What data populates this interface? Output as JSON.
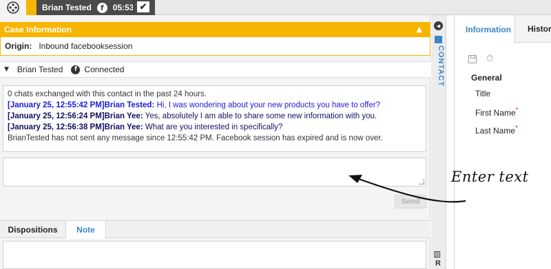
{
  "toolbar": {
    "contact_name": "Brian Tested",
    "channel_icon": "facebook-icon",
    "timer": "05:53"
  },
  "case": {
    "header": "Case Information",
    "origin_label": "Origin:",
    "origin_value": "Inbound facebooksession"
  },
  "contact": {
    "name": "Brian Tested",
    "status": "Connected"
  },
  "transcript": {
    "summary": "0 chats exchanged with this contact in the past 24 hours.",
    "messages": [
      {
        "meta": "[January 25, 12:55:42 PM]Brian Tested:",
        "text": " Hi, I was wondering about your new products you have to offer?"
      },
      {
        "meta": "[January 25, 12:56:24 PM]Brian Yee:",
        "text": " Yes, absolutely I am able to share some new information with you."
      },
      {
        "meta": "[January 25, 12:56:38 PM]Brian Yee:",
        "text": " What are you interested in specifically?"
      }
    ],
    "system_note": "BrianTested has not sent any message since 12:55:42 PM. Facebook session has expired and is now over."
  },
  "composer": {
    "send_label": "Send"
  },
  "bottom_tabs": {
    "dispositions": "Dispositions",
    "note": "Note"
  },
  "side_strip": {
    "contact_label": "CONTACT",
    "r_label": "R"
  },
  "info_panel": {
    "tab_information": "Information",
    "tab_history": "History",
    "general": "General",
    "fields": [
      "Title",
      "First Name",
      "Last Name"
    ],
    "required_mark": "*"
  },
  "annotation": {
    "text": "Enter text"
  },
  "colors": {
    "accent_orange": "#f7b500",
    "link_blue": "#3a86c8",
    "agent_blue": "#1a1adb"
  }
}
